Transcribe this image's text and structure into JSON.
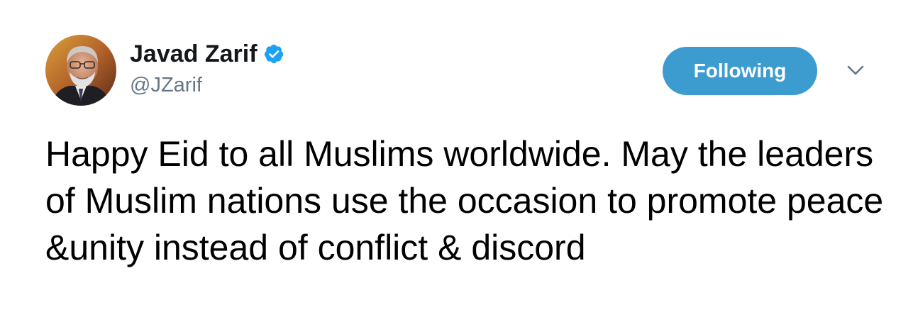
{
  "author": {
    "display_name": "Javad Zarif",
    "handle": "@JZarif",
    "verified": true,
    "verified_icon": "verified-badge-icon",
    "avatar": "profile-photo"
  },
  "actions": {
    "follow_label": "Following",
    "menu_icon": "chevron-down-icon"
  },
  "tweet": {
    "text": "Happy Eid to all Muslims worldwide. May the leaders of Muslim nations use the occasion to promote peace &unity instead of conflict & discord"
  },
  "colors": {
    "accent": "#3c9cd0",
    "verified": "#1da1f2",
    "handle": "#657786",
    "text": "#000000"
  }
}
